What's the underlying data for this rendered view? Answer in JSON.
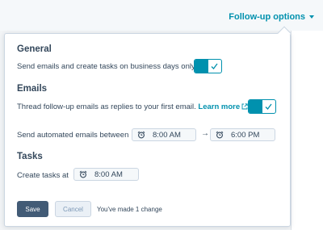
{
  "header": {
    "followup_label": "Follow-up options"
  },
  "sections": {
    "general": {
      "title": "General",
      "business_days_text": "Send emails and create tasks on business days only.",
      "business_days_enabled": true
    },
    "emails": {
      "title": "Emails",
      "thread_text": "Thread follow-up emails as replies to your first email.",
      "learn_more_label": "Learn more",
      "thread_enabled": true,
      "send_between_label": "Send automated emails between",
      "start_time": "8:00 AM",
      "range_arrow": "→",
      "end_time": "6:00 PM"
    },
    "tasks": {
      "title": "Tasks",
      "create_at_label": "Create tasks at",
      "create_time": "8:00 AM"
    }
  },
  "footer": {
    "save_label": "Save",
    "cancel_label": "Cancel",
    "change_note": "You've made 1 change"
  },
  "colors": {
    "accent": "#0091ae",
    "primary_button": "#425b76",
    "text": "#33475b"
  }
}
